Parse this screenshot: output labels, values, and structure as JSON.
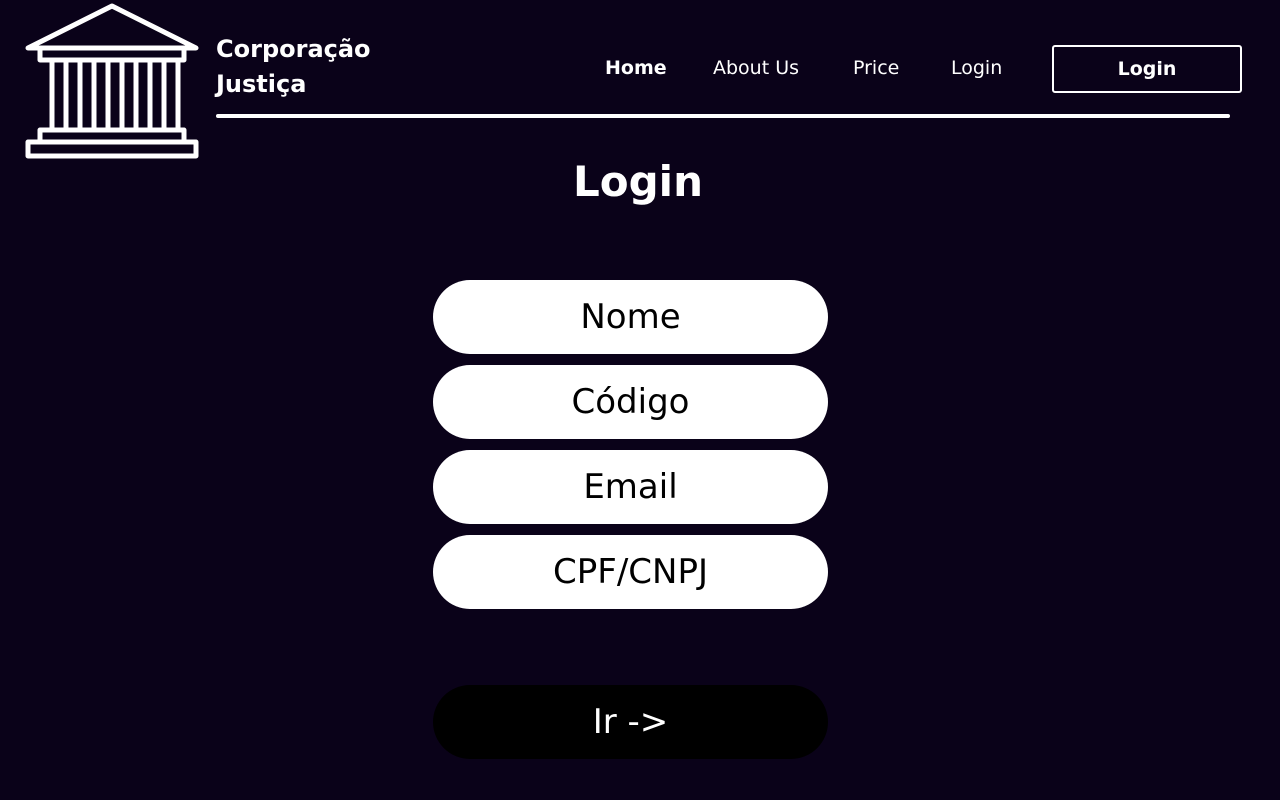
{
  "brand": {
    "line1": "Corporação",
    "line2": "Justiça",
    "logo_icon": "courthouse-icon"
  },
  "nav": {
    "items": [
      {
        "label": "Home",
        "active": true
      },
      {
        "label": "About Us",
        "active": false
      },
      {
        "label": "Price",
        "active": false
      },
      {
        "label": "Login",
        "active": false
      }
    ],
    "button_label": "Login"
  },
  "form": {
    "title": "Login",
    "fields": [
      {
        "placeholder": "Nome",
        "value": ""
      },
      {
        "placeholder": "Código",
        "value": ""
      },
      {
        "placeholder": "Email",
        "value": ""
      },
      {
        "placeholder": "CPF/CNPJ",
        "value": ""
      }
    ],
    "submit_label": "Ir ->"
  },
  "colors": {
    "background": "#0a0219",
    "foreground": "#ffffff",
    "field_background": "#ffffff",
    "submit_background": "#000000"
  }
}
